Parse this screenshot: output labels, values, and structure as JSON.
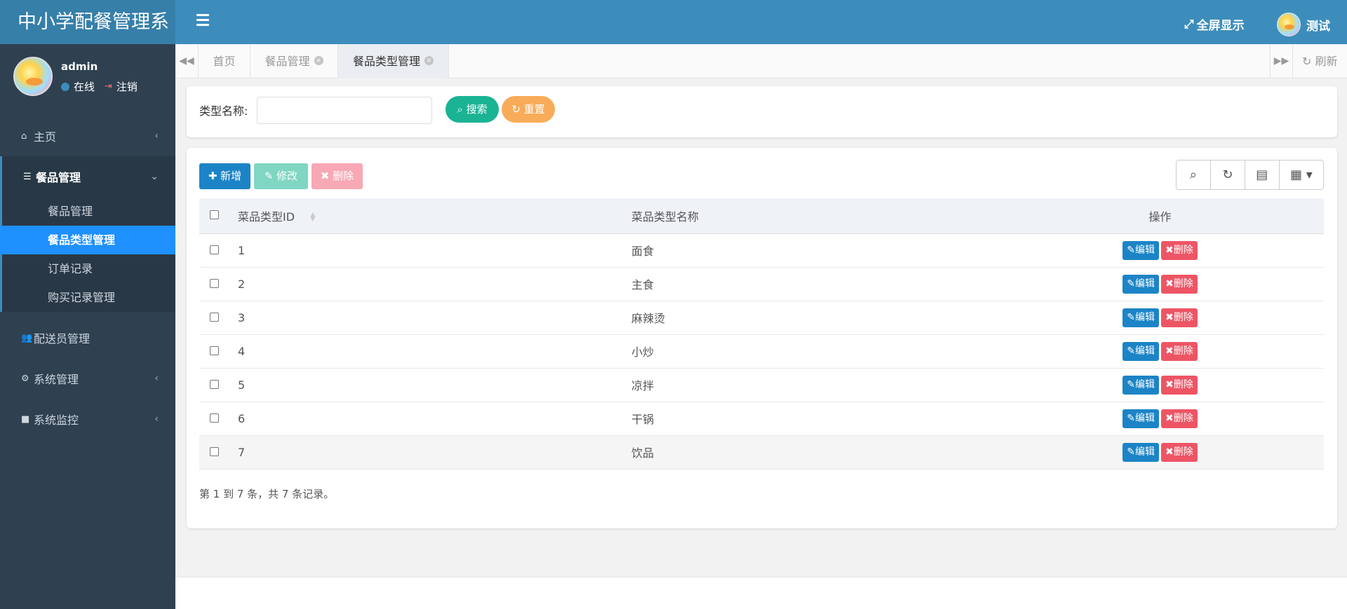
{
  "app": {
    "title": "中小学配餐管理系"
  },
  "header": {
    "fullscreen_label": "全屏显示",
    "user_name": "测试"
  },
  "user_panel": {
    "name": "admin",
    "status": "在线",
    "logout": "注销"
  },
  "sidebar": {
    "home": "主页",
    "meal_mgmt": "餐品管理",
    "sub": [
      "餐品管理",
      "餐品类型管理",
      "订单记录",
      "购买记录管理"
    ],
    "courier_mgmt": "配送员管理",
    "system_mgmt": "系统管理",
    "system_monitor": "系统监控"
  },
  "tabs": {
    "home": "首页",
    "meal": "餐品管理",
    "meal_type": "餐品类型管理",
    "refresh": "刷新"
  },
  "search": {
    "label": "类型名称:",
    "value": "",
    "search_btn": "搜索",
    "reset_btn": "重置"
  },
  "toolbar": {
    "add": "新增",
    "edit": "修改",
    "delete": "删除"
  },
  "table": {
    "headers": {
      "id": "菜品类型ID",
      "name": "菜品类型名称",
      "op": "操作"
    },
    "rows": [
      {
        "id": "1",
        "name": "面食"
      },
      {
        "id": "2",
        "name": "主食"
      },
      {
        "id": "3",
        "name": "麻辣烫"
      },
      {
        "id": "4",
        "name": "小炒"
      },
      {
        "id": "5",
        "name": "凉拌"
      },
      {
        "id": "6",
        "name": "干锅"
      },
      {
        "id": "7",
        "name": "饮品"
      }
    ],
    "edit_label": "编辑",
    "delete_label": "删除"
  },
  "pager": {
    "text": "第 1 到 7 条，共 7 条记录。"
  },
  "colors": {
    "header": "#3c8dbc",
    "sidebar": "#2f4050",
    "active_menu": "#1e90ff",
    "primary": "#1c84c6",
    "success": "#1ab394",
    "warning": "#f8ac59",
    "danger": "#ed5565"
  }
}
